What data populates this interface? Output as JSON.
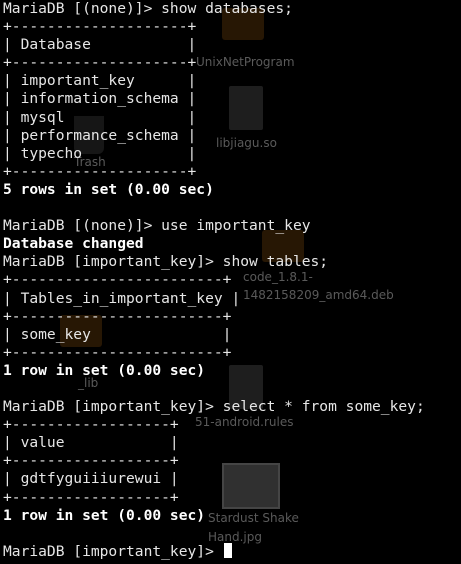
{
  "terminal": {
    "lines": [
      "MariaDB [(none)]> show databases;",
      "+--------------------+",
      "| Database           |",
      "+--------------------+",
      "| important_key      |",
      "| information_schema |",
      "| mysql              |",
      "| performance_schema |",
      "| typecho            |",
      "+--------------------+",
      "5 rows in set (0.00 sec)",
      "",
      "MariaDB [(none)]> use important_key",
      "Database changed",
      "MariaDB [important_key]> show tables;",
      "+------------------------+",
      "| Tables_in_important_key |",
      "+------------------------+",
      "| some_key               |",
      "+------------------------+",
      "1 row in set (0.00 sec)",
      "",
      "MariaDB [important_key]> select * from some_key;",
      "+------------------+",
      "| value            |",
      "+------------------+",
      "| gdtfyguiiiurewui |",
      "+------------------+",
      "1 row in set (0.00 sec)",
      "",
      "MariaDB [important_key]> "
    ]
  },
  "desktop": {
    "labels": [
      "UnixNetProgram",
      "libjiagu.so",
      "Trash",
      "code_1.8.1-1482158209_amd64.deb",
      "_lib",
      "51-android.rules",
      "Stardust Shake Hand.jpg"
    ]
  }
}
